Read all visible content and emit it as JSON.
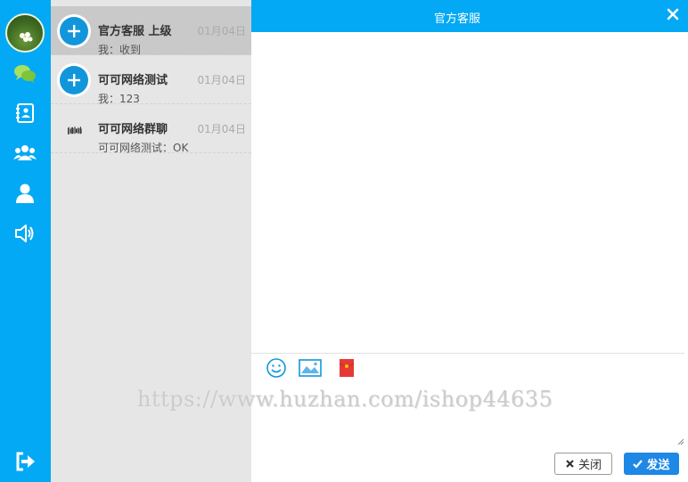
{
  "colors": {
    "rail": "#03a9f4",
    "header": "#03a9f4",
    "list_bg": "#e6e6e6",
    "active_item": "#c9c9c9",
    "send": "#1e88e5",
    "icon_green": "#a8e063"
  },
  "rail": {
    "icons": [
      "chat-icon",
      "contacts-icon",
      "group-icon",
      "profile-icon",
      "speaker-icon",
      "logout-icon"
    ]
  },
  "conversations": [
    {
      "name": "官方客服 上级",
      "time": "01月04日",
      "last": "我：收到",
      "active": true,
      "avatar": "plus-icon"
    },
    {
      "name": "可可网络测试",
      "time": "01月04日",
      "last": "我：123",
      "active": false,
      "avatar": "plus-icon"
    },
    {
      "name": "可可网络群聊",
      "time": "01月04日",
      "last": "可可网络测试：OK",
      "active": false,
      "avatar": "qr-code-icon"
    }
  ],
  "chat": {
    "title": "官方客服",
    "tools": [
      "emoji-icon",
      "image-icon",
      "red-packet-icon"
    ],
    "watermark": "https://www.huzhan.com/ishop44635",
    "close_label": "关闭",
    "send_label": "发送"
  }
}
